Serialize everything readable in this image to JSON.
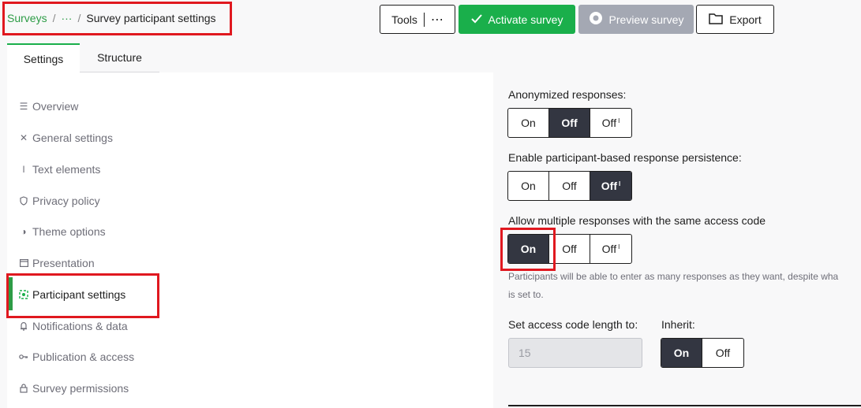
{
  "breadcrumb": {
    "root": "Surveys",
    "ellipsis": "···",
    "separator": "/",
    "current": "Survey participant settings"
  },
  "toolbar": {
    "tools_label": "Tools",
    "tools_more": "⋯",
    "activate_label": "Activate survey",
    "preview_label": "Preview survey",
    "export_label": "Export"
  },
  "tabs": [
    {
      "label": "Settings",
      "active": true
    },
    {
      "label": "Structure",
      "active": false
    }
  ],
  "sidebar": {
    "items": [
      {
        "label": "Overview",
        "icon": "overview-icon"
      },
      {
        "label": "General settings",
        "icon": "tools-icon"
      },
      {
        "label": "Text elements",
        "icon": "text-icon"
      },
      {
        "label": "Privacy policy",
        "icon": "shield-icon"
      },
      {
        "label": "Theme options",
        "icon": "contrast-icon"
      },
      {
        "label": "Presentation",
        "icon": "presentation-icon"
      },
      {
        "label": "Participant settings",
        "icon": "participants-icon",
        "active": true
      },
      {
        "label": "Notifications & data",
        "icon": "bell-icon"
      },
      {
        "label": "Publication & access",
        "icon": "key-icon"
      },
      {
        "label": "Survey permissions",
        "icon": "lock-icon"
      }
    ]
  },
  "settings": {
    "anonymized": {
      "label": "Anonymized responses:",
      "options": [
        "On",
        "Off",
        "Off"
      ],
      "selected": "Off (middle)"
    },
    "persistence": {
      "label": "Enable participant-based response persistence:",
      "options": [
        "On",
        "Off",
        "Off"
      ],
      "selected": "Off (inherited)"
    },
    "multiple": {
      "label": "Allow multiple responses with the same access code",
      "options": [
        "On",
        "Off",
        "Off"
      ],
      "selected": "On",
      "hint_line1": "Participants will be able to enter as many responses as they want, despite wha",
      "hint_line2": "is set to."
    },
    "access_code": {
      "label": "Set access code length to:",
      "value": "15",
      "inherit_label": "Inherit:",
      "inherit_options": [
        "On",
        "Off"
      ],
      "inherit_selected": "On"
    },
    "inherit_marker": "I"
  },
  "colors": {
    "accent_green": "#1aaf4b",
    "selected_dark": "#333641",
    "highlight_red": "#e0181f"
  }
}
